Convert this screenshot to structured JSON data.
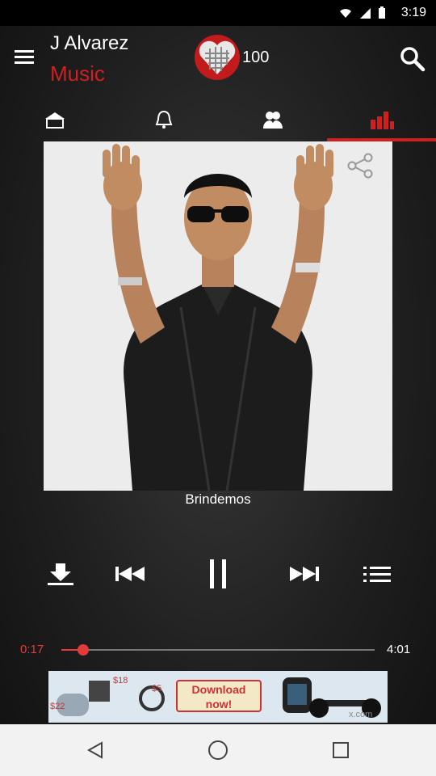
{
  "status": {
    "time": "3:19"
  },
  "header": {
    "artist": "J Alvarez",
    "section": "Music",
    "score": "100",
    "accent": "#d11f1f"
  },
  "tabs": [
    {
      "icon": "home-icon",
      "active": false
    },
    {
      "icon": "bell-icon",
      "active": false
    },
    {
      "icon": "users-icon",
      "active": false
    },
    {
      "icon": "chart-bars-icon",
      "active": true
    }
  ],
  "player": {
    "song_title": "Brindemos",
    "elapsed": "0:17",
    "duration": "4:01",
    "progress_fraction": 0.07,
    "state": "playing"
  },
  "ad": {
    "prices": [
      "$18",
      "$5",
      "$22"
    ],
    "cta": "Download now!",
    "domain": "x.com"
  }
}
